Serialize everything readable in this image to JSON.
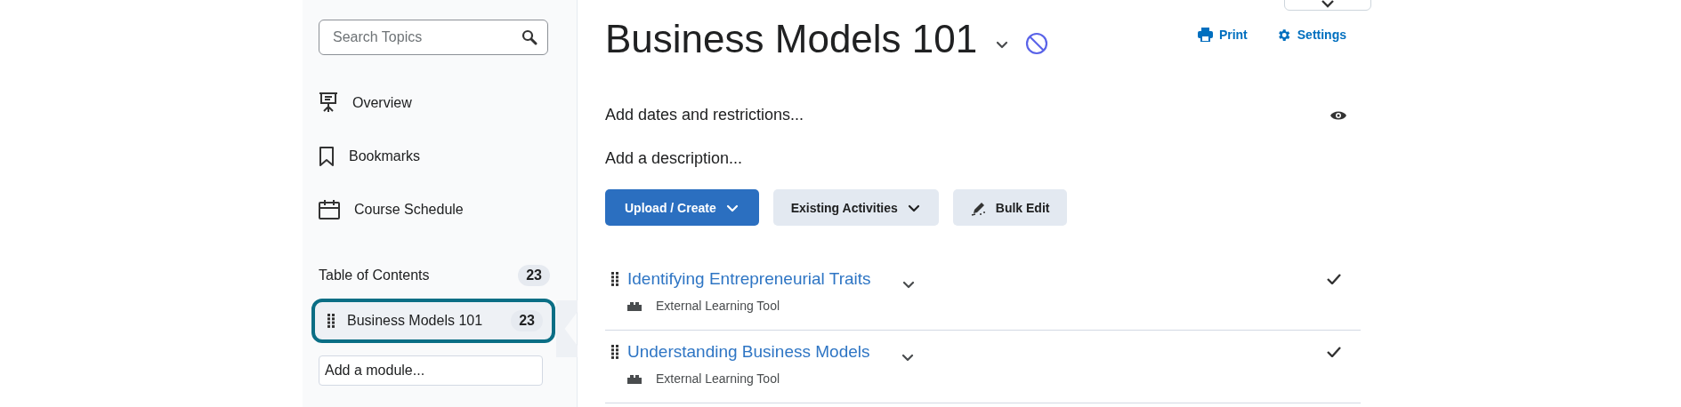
{
  "sidebar": {
    "search": {
      "placeholder": "Search Topics"
    },
    "nav_items": [
      {
        "label": "Overview"
      },
      {
        "label": "Bookmarks"
      },
      {
        "label": "Course Schedule"
      }
    ],
    "toc": {
      "label": "Table of Contents",
      "count": "23"
    },
    "modules": [
      {
        "label": "Business Models 101",
        "count": "23",
        "selected": true
      }
    ],
    "add_module": {
      "placeholder": "Add a module..."
    }
  },
  "main": {
    "title": "Business Models 101",
    "actions": [
      {
        "label": "Print"
      },
      {
        "label": "Settings"
      }
    ],
    "dates_link": "Add dates and restrictions...",
    "description_link": "Add a description...",
    "buttons": [
      {
        "label": "Upload / Create",
        "kind": "primary"
      },
      {
        "label": "Existing Activities",
        "kind": "dropdown"
      },
      {
        "label": "Bulk Edit",
        "kind": "edit"
      }
    ],
    "topics": [
      {
        "title": "Identifying Entrepreneurial Traits",
        "type": "External Learning Tool",
        "completed": true
      },
      {
        "title": "Understanding Business Models",
        "type": "External Learning Tool",
        "completed": true
      }
    ]
  }
}
